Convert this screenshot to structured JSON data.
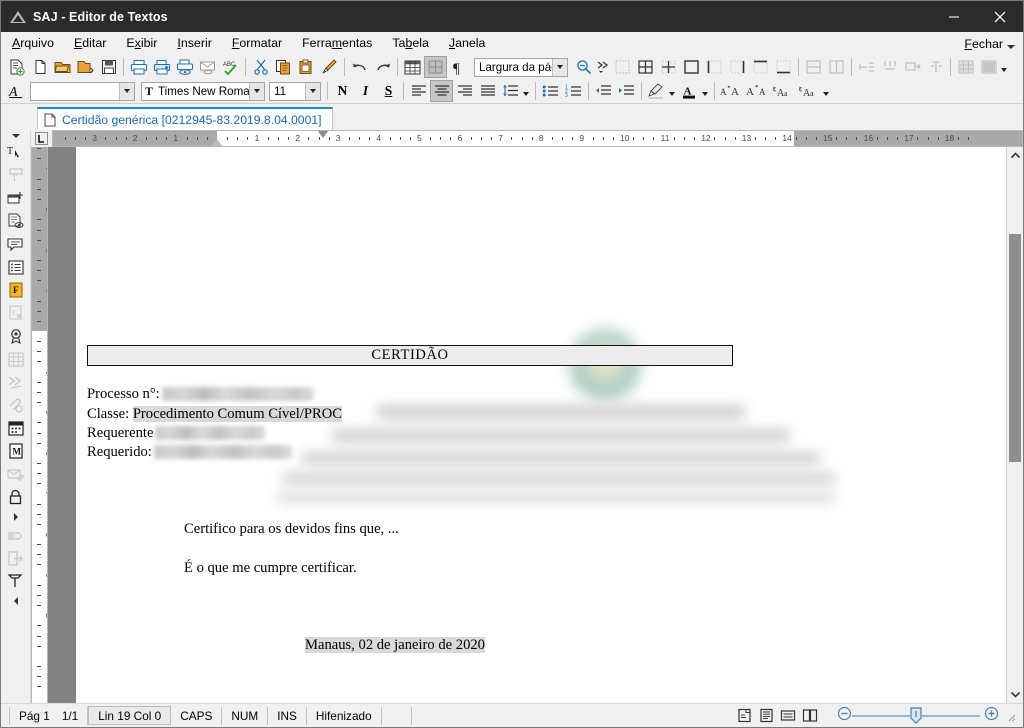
{
  "window": {
    "title": "SAJ - Editor de Textos",
    "icon": "saj-logo-icon",
    "controls": {
      "minimize": "minimize-icon",
      "close": "close-icon"
    }
  },
  "menubar": {
    "items": [
      {
        "label": "Arquivo",
        "accel_index": 0
      },
      {
        "label": "Editar",
        "accel_index": 0
      },
      {
        "label": "Exibir",
        "accel_index": 1
      },
      {
        "label": "Inserir",
        "accel_index": 0
      },
      {
        "label": "Formatar",
        "accel_index": 0
      },
      {
        "label": "Ferramentas",
        "accel_index": 5
      },
      {
        "label": "Tabela",
        "accel_index": 2
      },
      {
        "label": "Janela",
        "accel_index": 0
      }
    ],
    "close_label": "Fechar",
    "close_accel_index": 0
  },
  "toolbar_row1": {
    "buttons": [
      "new-document-with-model-icon",
      "blank-document-icon",
      "open-folder-icon",
      "open-model-icon",
      "save-icon",
      "sep",
      "print-icon",
      "print-setup-icon",
      "print-preview-icon",
      "send-mail-icon",
      "spellcheck-icon",
      "sep",
      "cut-icon",
      "copy-icon",
      "paste-icon",
      "format-painter-icon",
      "sep",
      "undo-icon",
      "redo-icon",
      "sep",
      "insert-table-icon",
      "table-properties-icon",
      "show-marks-icon"
    ],
    "zoom_value": "Largura da págin",
    "zoom_search_icon": "zoom-out-icon",
    "more_buttons": [
      "merge-more-icon",
      "select-table-icon",
      "all-borders-icon",
      "inside-borders-icon",
      "outside-border-icon",
      "left-border-icon",
      "right-border-icon",
      "top-border-icon",
      "bottom-border-icon",
      "sep",
      "merge-cells-icon",
      "split-cells-icon",
      "sep",
      "distribute-rows-icon",
      "distribute-columns-icon",
      "insert-row-icon",
      "insert-column-icon",
      "sep",
      "table-autoformat-icon",
      "table-shading-icon"
    ]
  },
  "toolbar_row2": {
    "style_icon": "paragraph-style-icon",
    "style_value": "",
    "font_icon": "font-type-icon",
    "font_value": "Times New Romar",
    "size_value": "11",
    "buttons": [
      "bold-icon",
      "italic-icon",
      "underline-icon",
      "sep",
      "align-left-icon",
      "align-center-icon",
      "align-right-icon",
      "align-justify-icon",
      "line-spacing-icon",
      "sep",
      "bullet-list-icon",
      "numbered-list-icon",
      "sep",
      "decrease-indent-icon",
      "increase-indent-icon",
      "sep",
      "highlight-color-icon",
      "font-color-icon",
      "sep",
      "increase-font-icon",
      "decrease-font-icon",
      "uppercase-icon",
      "lowercase-icon"
    ],
    "bold_label": "N",
    "italic_label": "I",
    "underline_label": "S",
    "active_button": "align-center-icon"
  },
  "tab": {
    "icon": "document-icon",
    "label": "Certidão genérica [0212945-83.2019.8.04.0001]"
  },
  "left_rail": {
    "items": [
      "collapse-caret-icon",
      "text-select-icon",
      "header-footer-icon",
      "insert-field-icon",
      "document-properties-icon",
      "comment-icon",
      "list-items-icon",
      "flag-marker-icon",
      "remove-field-icon",
      "signature-icon",
      "table-grid-icon",
      "merge-doc-icon",
      "attachment-icon",
      "calendar-icon",
      "model-icon",
      "envelope-icon",
      "lock-icon",
      "expand-caret-icon",
      "seal-icon",
      "export-icon",
      "stamp-icon",
      "scroll-left-icon"
    ]
  },
  "ruler": {
    "horizontal_unit_labels_left": [
      "3",
      "2",
      "1"
    ],
    "horizontal_unit_labels_right": [
      "1",
      "2",
      "3",
      "4",
      "5",
      "6",
      "7",
      "8",
      "9",
      "10",
      "11",
      "12",
      "13",
      "14",
      "15",
      "16",
      "17",
      "18"
    ],
    "vertical_unit_labels_top": [
      "4",
      "3",
      "2",
      "1"
    ],
    "vertical_unit_labels_body": [
      "1",
      "2",
      "3",
      "4",
      "5",
      "6",
      "7"
    ],
    "tab_selector_icon": "left-tab-stop-icon"
  },
  "document": {
    "header_note": "blurred court letterhead with emblem",
    "title_box": "CERTIDÃO",
    "fields": [
      {
        "label": "Processo n°:",
        "redacted": true,
        "value": "",
        "redact_width": 150
      },
      {
        "label": "Classe: ",
        "redacted": false,
        "value": "Procedimento Comum Cível/PROC",
        "highlight": true
      },
      {
        "label": "Requerente",
        "redacted": true,
        "value": "",
        "redact_width": 108
      },
      {
        "label": "Requerido:",
        "redacted": true,
        "value": "",
        "redact_width": 136
      }
    ],
    "body": [
      "Certifico para os devidos fins que, ...",
      "É o que me cumpre certificar."
    ],
    "signature_line": {
      "city": "Manaus",
      "rest": ", 02 de janeiro de 2020"
    }
  },
  "statusbar": {
    "page": "Pág 1",
    "page_count": "1/1",
    "position": "Lin 19  Col 0",
    "caps": "CAPS",
    "num": "NUM",
    "ins": "INS",
    "hyphen": "Hifenizado",
    "extra": "",
    "view_buttons": [
      "page-layout-view-icon",
      "reading-view-icon",
      "web-view-icon",
      "two-page-view-icon"
    ],
    "zoom_out_icon": "zoom-minus-icon",
    "zoom_in_icon": "zoom-plus-icon",
    "resize_grip": "resize-grip-icon"
  },
  "colors": {
    "titlebar_bg": "#2b2b2b",
    "chrome_bg": "#f0f0f0",
    "tab_accent": "#1c8ad4",
    "tab_text": "#1668b8",
    "page_bg": "#828282",
    "icon_blue": "#1f6fb5",
    "icon_orange": "#e8a33d"
  }
}
